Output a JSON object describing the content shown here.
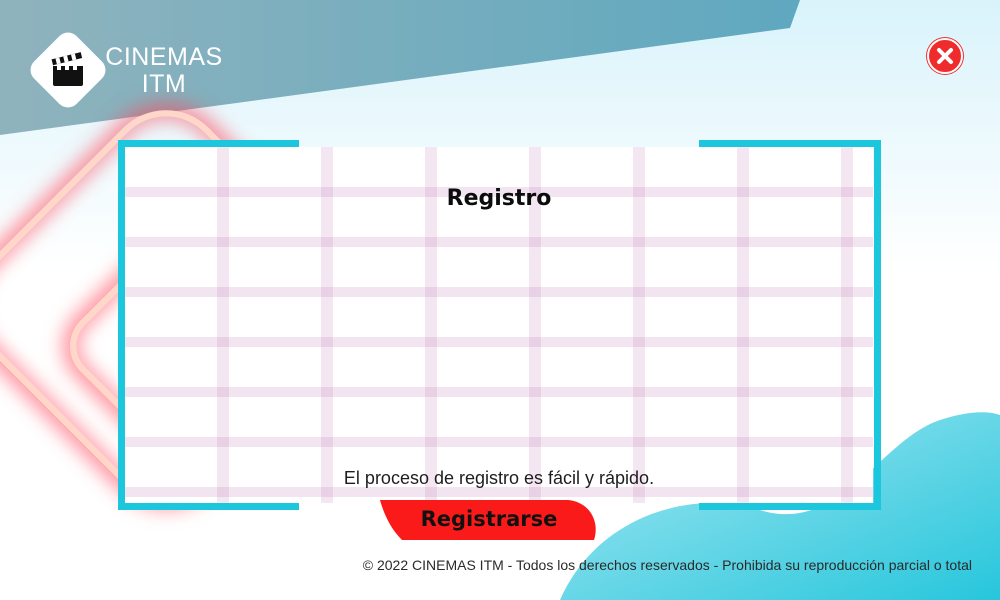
{
  "brand": {
    "name_line1": "CINEMAS",
    "name_line2": "ITM",
    "logo_icon": "clapperboard-icon"
  },
  "window": {
    "close_icon": "close-icon"
  },
  "panel": {
    "title": "Registro",
    "description": "El proceso de registro es fácil y rápido.",
    "register_label": "Registrarse"
  },
  "footer": {
    "copyright": "© 2022 CINEMAS ITM - Todos los derechos reservados - Prohibida su reproducción parcial o total"
  },
  "colors": {
    "accent_cyan": "#1cc6dd",
    "button_red": "#fb1a1a",
    "close_red": "#f02b2b",
    "banner_gray": "#8fb4bf"
  }
}
